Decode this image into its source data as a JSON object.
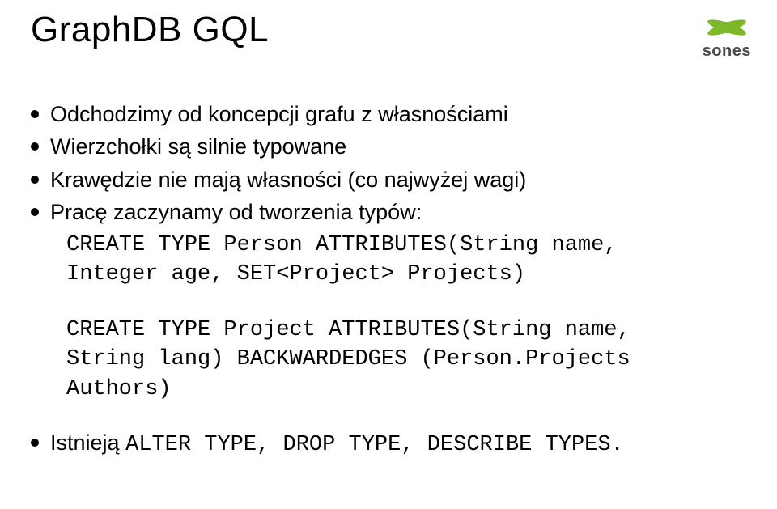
{
  "title": "GraphDB GQL",
  "logo": {
    "brand": "sones"
  },
  "bullets": {
    "b1": "Odchodzimy od koncepcji grafu z własnościami",
    "b2": "Wierzchołki są silnie typowane",
    "b3": "Krawędzie nie mają własności (co najwyżej wagi)",
    "b4": "Pracę zaczynamy od tworzenia typów:"
  },
  "code1": {
    "l1": "CREATE TYPE Person ATTRIBUTES(String name,",
    "l2": "Integer age, SET<Project> Projects)"
  },
  "code2": {
    "l1": "CREATE TYPE Project ATTRIBUTES(String name,",
    "l2": "String lang) BACKWARDEDGES (Person.Projects",
    "l3": "Authors)"
  },
  "bullets2": {
    "b5_prefix": "Istnieją ",
    "b5_code": "ALTER TYPE, DROP TYPE, DESCRIBE TYPES."
  }
}
